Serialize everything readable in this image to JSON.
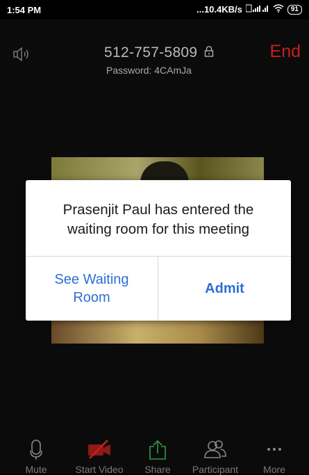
{
  "status_bar": {
    "time": "1:54 PM",
    "network": "...10.4KB/s",
    "battery": "91"
  },
  "meeting": {
    "meeting_id": "512-757-5809",
    "password": "Password: 4CAmJa",
    "end_label": "End"
  },
  "dialog": {
    "message_line1": "Prasenjit Paul has entered the",
    "message_line2": "waiting room for this meeting",
    "see_waiting_line1": "See Waiting",
    "see_waiting_line2": "Room",
    "admit_label": "Admit"
  },
  "toolbar": {
    "mute_label": "Mute",
    "start_video_label": "Start Video",
    "share_label": "Share",
    "participants_label": "Participant",
    "more_label": "More"
  },
  "colors": {
    "end_red": "#c6201d",
    "link_blue": "#2d6fd6",
    "share_green": "#2e9b47",
    "video_off_red": "#c6201d"
  },
  "icons": [
    "speaker-icon",
    "lock-icon",
    "microphone-icon",
    "video-off-icon",
    "share-icon",
    "participants-icon",
    "more-icon",
    "wifi-icon",
    "signal-icon",
    "battery-icon"
  ]
}
